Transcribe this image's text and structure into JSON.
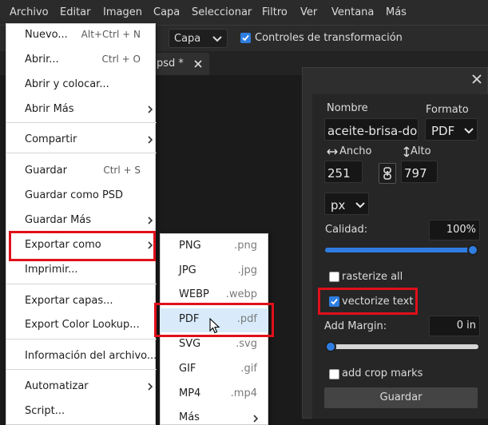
{
  "menubar": {
    "items": [
      "Archivo",
      "Editar",
      "Imagen",
      "Capa",
      "Seleccionar",
      "Filtro",
      "Ver",
      "Ventana",
      "Más"
    ]
  },
  "options_bar": {
    "layer_select": "Capa",
    "transform_controls_label": "Controles de transformación",
    "transform_controls_checked": true
  },
  "tab": {
    "title": "psd *",
    "close_icon": "close-icon"
  },
  "file_menu": {
    "items": [
      {
        "label": "Nuevo...",
        "shortcut": "Alt+Ctrl + N"
      },
      {
        "label": "Abrir...",
        "shortcut": "Ctrl + O"
      },
      {
        "label": "Abrir y colocar...",
        "shortcut": ""
      },
      {
        "label": "Abrir Más",
        "shortcut": "",
        "submenu": true
      },
      {
        "label": "Compartir",
        "shortcut": "",
        "submenu": true
      },
      {
        "label": "Guardar",
        "shortcut": "Ctrl + S"
      },
      {
        "label": "Guardar como PSD",
        "shortcut": ""
      },
      {
        "label": "Guardar Más",
        "shortcut": "",
        "submenu": true
      },
      {
        "label": "Exportar como",
        "shortcut": "",
        "submenu": true
      },
      {
        "label": "Imprimir...",
        "shortcut": ""
      },
      {
        "label": "Exportar capas...",
        "shortcut": ""
      },
      {
        "label": "Export Color Lookup...",
        "shortcut": ""
      },
      {
        "label": "Información del archivo...",
        "shortcut": ""
      },
      {
        "label": "Automatizar",
        "shortcut": "",
        "submenu": true
      },
      {
        "label": "Script...",
        "shortcut": ""
      }
    ]
  },
  "export_submenu": {
    "items": [
      {
        "label": "PNG",
        "ext": ".png"
      },
      {
        "label": "JPG",
        "ext": ".jpg"
      },
      {
        "label": "WEBP",
        "ext": ".webp"
      },
      {
        "label": "PDF",
        "ext": ".pdf"
      },
      {
        "label": "SVG",
        "ext": ".svg"
      },
      {
        "label": "GIF",
        "ext": ".gif"
      },
      {
        "label": "MP4",
        "ext": ".mp4"
      },
      {
        "label": "Más",
        "ext": ""
      }
    ],
    "highlighted": "PDF"
  },
  "export_panel": {
    "name_label": "Nombre",
    "name_value": "aceite-brisa-dor",
    "format_label": "Formato",
    "format_value": "PDF",
    "width_label": "Ancho",
    "width_value": "251",
    "height_label": "Alto",
    "height_value": "797",
    "unit_value": "px",
    "quality_label": "Calidad:",
    "quality_value": "100%",
    "quality_level": 1.0,
    "rasterize_label": "rasterize all",
    "rasterize_checked": false,
    "vectorize_label": "vectorize text",
    "vectorize_checked": true,
    "margin_label": "Add Margin:",
    "margin_value": "0 in",
    "margin_level": 0.0,
    "crop_marks_label": "add crop marks",
    "crop_marks_checked": false,
    "save_label": "Guardar"
  },
  "colors": {
    "accent": "#2f7de1",
    "highlight_border": "#e0101a"
  }
}
